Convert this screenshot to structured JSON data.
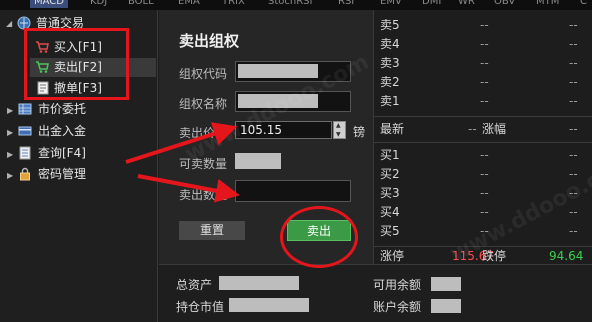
{
  "indicator_tabs": [
    "MACD",
    "KDJ",
    "BOLL",
    "EMA",
    "TRIX",
    "StochRSI",
    "RSI",
    "EMV",
    "DMI",
    "WR",
    "OBV",
    "MTM",
    "C"
  ],
  "sidebar": {
    "group_label": "普通交易",
    "sub_items": [
      {
        "label": "买入[F1]",
        "icon": "cart-buy-icon"
      },
      {
        "label": "卖出[F2]",
        "icon": "cart-sell-icon"
      },
      {
        "label": "撤单[F3]",
        "icon": "document-cancel-icon"
      }
    ],
    "items": [
      {
        "label": "市价委托",
        "icon": "grid-icon"
      },
      {
        "label": "出金入金",
        "icon": "card-icon"
      },
      {
        "label": "查询[F4]",
        "icon": "search-list-icon"
      },
      {
        "label": "密码管理",
        "icon": "lock-icon"
      }
    ]
  },
  "order_form": {
    "title": "卖出组权",
    "labels": {
      "code": "组权代码",
      "name": "组权名称",
      "price": "卖出价格",
      "available": "可卖数量",
      "quantity": "卖出数量"
    },
    "price_value": "105.15",
    "price_unit": "镑",
    "reset_label": "重置",
    "sell_label": "卖出"
  },
  "quote": {
    "sell_levels": [
      {
        "label": "卖5",
        "price": "--",
        "vol": "--"
      },
      {
        "label": "卖4",
        "price": "--",
        "vol": "--"
      },
      {
        "label": "卖3",
        "price": "--",
        "vol": "--"
      },
      {
        "label": "卖2",
        "price": "--",
        "vol": "--"
      },
      {
        "label": "卖1",
        "price": "--",
        "vol": "--"
      }
    ],
    "latest_label": "最新",
    "latest_value": "--",
    "change_label": "涨幅",
    "change_value": "--",
    "buy_levels": [
      {
        "label": "买1",
        "price": "--",
        "vol": "--"
      },
      {
        "label": "买2",
        "price": "--",
        "vol": "--"
      },
      {
        "label": "买3",
        "price": "--",
        "vol": "--"
      },
      {
        "label": "买4",
        "price": "--",
        "vol": "--"
      },
      {
        "label": "买5",
        "price": "--",
        "vol": "--"
      }
    ],
    "limit_up_label": "涨停",
    "limit_up_value": "115.67",
    "limit_down_label": "跌停",
    "limit_down_value": "94.64"
  },
  "account": {
    "total_assets_label": "总资产",
    "holdings_value_label": "持仓市值",
    "available_balance_label": "可用余额",
    "account_balance_label": "账户余额"
  },
  "watermark": "www.ddooo.com",
  "colors": {
    "annotation_red": "#e4161c",
    "sell_button_green": "#3a9a46",
    "limit_up_red": "#ff4b4b",
    "limit_down_green": "#3ccf4e"
  }
}
